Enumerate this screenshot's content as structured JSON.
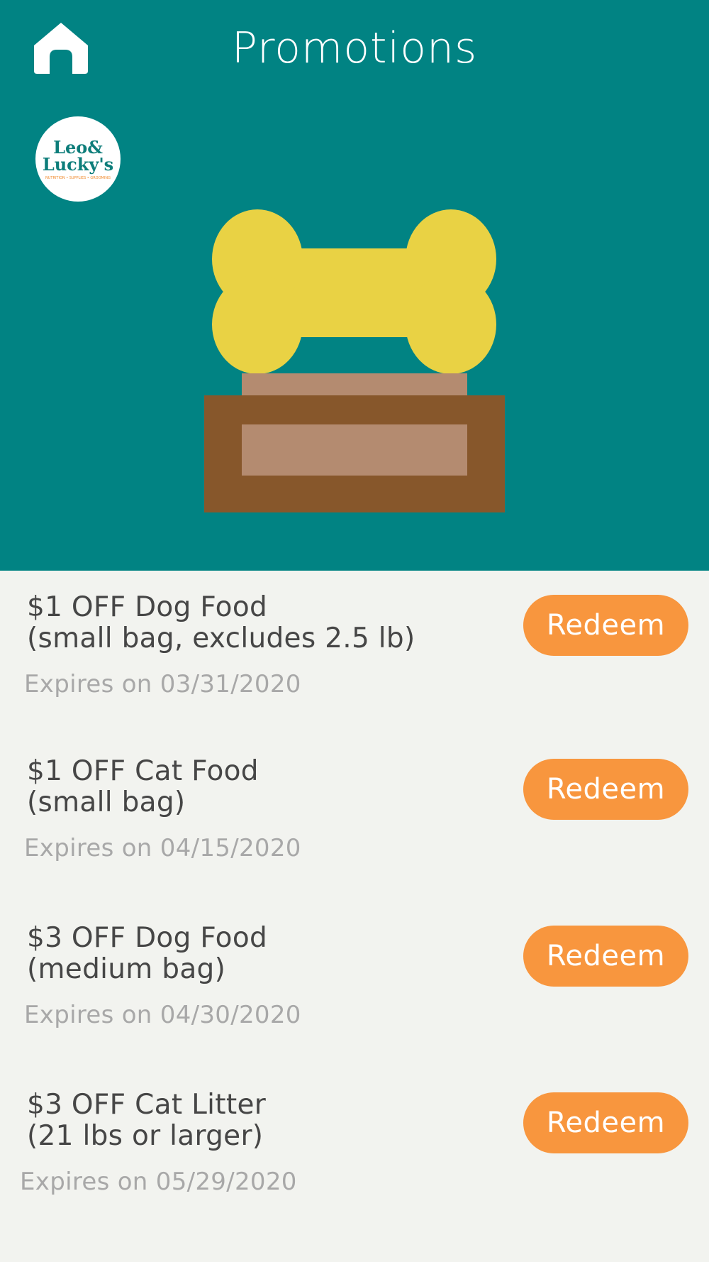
{
  "header": {
    "title": "Promotions",
    "home_icon": "home-icon",
    "background": "#018383"
  },
  "logo": {
    "line1": "Leo&",
    "line2": "Lucky's",
    "tagline": "NUTRITION • SUPPLIES • GROOMING"
  },
  "illustration": {
    "icon": "bone-on-pedestal-icon",
    "bone_color": "#e9d244",
    "pedestal_dark": "#87572b",
    "pedestal_light": "#b48b70"
  },
  "promotions": [
    {
      "title": "$1 OFF Dog Food\n(small bag, excludes 2.5 lb)",
      "expiry": "Expires on 03/31/2020",
      "button": "Redeem"
    },
    {
      "title": "$1 OFF Cat Food\n(small bag)",
      "expiry": "Expires on 04/15/2020",
      "button": "Redeem"
    },
    {
      "title": "$3 OFF Dog Food\n(medium bag)",
      "expiry": "Expires on 04/30/2020",
      "button": "Redeem"
    },
    {
      "title": "$3 OFF Cat Litter\n(21 lbs or larger)",
      "expiry": "Expires on 05/29/2020",
      "button": "Redeem"
    }
  ],
  "colors": {
    "accent": "#f8963e",
    "list_background": "#f2f3ef"
  }
}
